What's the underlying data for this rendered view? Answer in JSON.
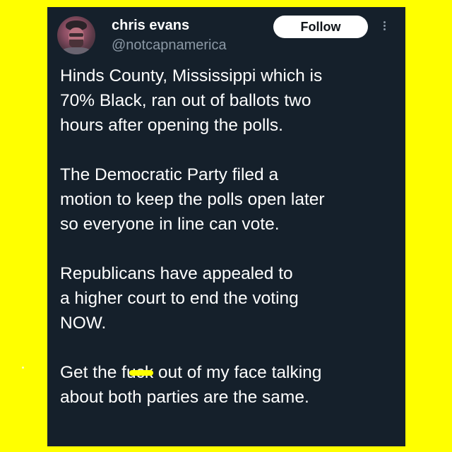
{
  "colors": {
    "background": "#ffff00",
    "card": "#15202b",
    "text": "#ffffff",
    "muted": "#8b98a5",
    "button": "#ffffff"
  },
  "author": {
    "display_name": "chris evans",
    "handle": "@notcapnamerica",
    "avatar_icon": "profile-photo"
  },
  "actions": {
    "follow_label": "Follow",
    "more_icon": "more-vertical-icon"
  },
  "tweet": {
    "paragraphs": [
      {
        "lines": [
          "Hinds County, Mississippi which is",
          "70% Black, ran out of ballots two",
          "hours after opening the polls."
        ]
      },
      {
        "lines": [
          "The Democratic Party filed a",
          "motion to keep the polls open later",
          "so everyone in line can vote."
        ]
      },
      {
        "lines": [
          "Republicans have appealed to",
          "a higher court to end the voting",
          "NOW."
        ]
      }
    ],
    "last_paragraph": {
      "line1_before": "Get the f",
      "line1_censored": "uck",
      "line1_after": " out of my face talking",
      "line2": "about both parties are the same."
    }
  }
}
